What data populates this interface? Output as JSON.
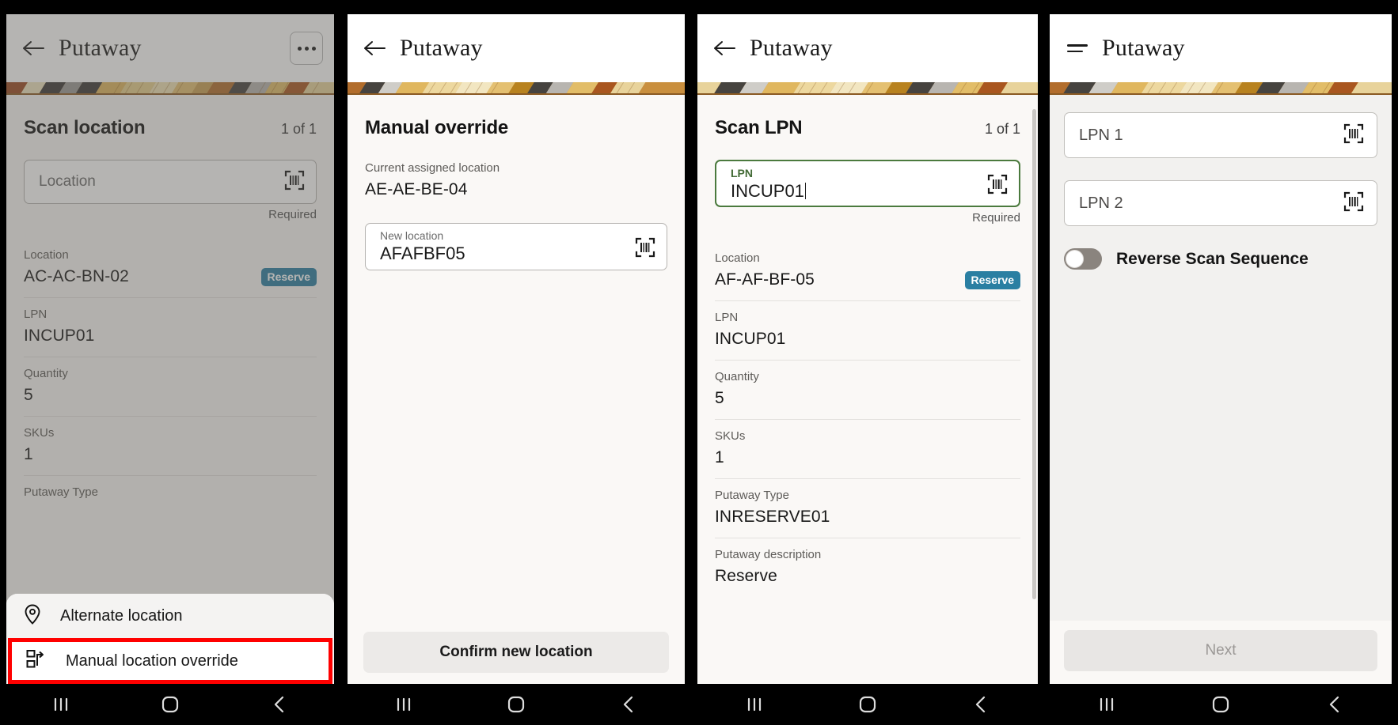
{
  "app": {
    "title": "Putaway"
  },
  "colors": {
    "badge_teal": "#2a7fa2",
    "focus_green": "#4b7a3e",
    "highlight_red": "#ff0000",
    "screen_bg": "#faf8f6",
    "dim_overlay": "rgba(90,88,85,0.45)"
  },
  "panel1": {
    "title": "Putaway",
    "back_icon": "arrow-left-icon",
    "overflow_icon": "kebab-menu-icon",
    "heading": "Scan location",
    "count": "1 of 1",
    "field": {
      "label": "Location",
      "value": "",
      "helper": "Required",
      "scan_icon": "barcode-scan-icon"
    },
    "details": [
      {
        "label": "Location",
        "value": "AC-AC-BN-02",
        "badge": "Reserve"
      },
      {
        "label": "LPN",
        "value": "INCUP01",
        "badge": ""
      },
      {
        "label": "Quantity",
        "value": "5",
        "badge": ""
      },
      {
        "label": "SKUs",
        "value": "1",
        "badge": ""
      },
      {
        "label": "Putaway Type",
        "value": "",
        "badge": ""
      }
    ],
    "sheet": [
      {
        "label": "Alternate location",
        "icon": "map-pin-icon",
        "highlighted": false
      },
      {
        "label": "Manual location override",
        "icon": "screen-override-icon",
        "highlighted": true
      }
    ]
  },
  "panel2": {
    "title": "Putaway",
    "back_icon": "arrow-left-icon",
    "heading": "Manual override",
    "current_label": "Current assigned location",
    "current_value": "AE-AE-BE-04",
    "field": {
      "label": "New location",
      "value": "AFAFBF05",
      "scan_icon": "barcode-scan-icon"
    },
    "confirm_button": "Confirm new location"
  },
  "panel3": {
    "title": "Putaway",
    "back_icon": "arrow-left-icon",
    "heading": "Scan LPN",
    "count": "1 of 1",
    "field": {
      "label": "LPN",
      "value": "INCUP01",
      "helper": "Required",
      "scan_icon": "barcode-scan-icon"
    },
    "details": [
      {
        "label": "Location",
        "value": "AF-AF-BF-05",
        "badge": "Reserve"
      },
      {
        "label": "LPN",
        "value": "INCUP01",
        "badge": ""
      },
      {
        "label": "Quantity",
        "value": "5",
        "badge": ""
      },
      {
        "label": "SKUs",
        "value": "1",
        "badge": ""
      },
      {
        "label": "Putaway Type",
        "value": "INRESERVE01",
        "badge": ""
      },
      {
        "label": "Putaway description",
        "value": "Reserve",
        "badge": ""
      }
    ]
  },
  "panel4": {
    "title": "Putaway",
    "menu_icon": "hamburger-menu-icon",
    "fields": [
      {
        "label": "LPN 1",
        "scan_icon": "barcode-scan-icon"
      },
      {
        "label": "LPN 2",
        "scan_icon": "barcode-scan-icon"
      }
    ],
    "toggle": {
      "label": "Reverse Scan Sequence",
      "on": false
    },
    "next_button": "Next"
  },
  "navbar": {
    "recents_icon": "recents-icon",
    "home_icon": "home-icon",
    "back_icon": "chevron-left-icon"
  }
}
